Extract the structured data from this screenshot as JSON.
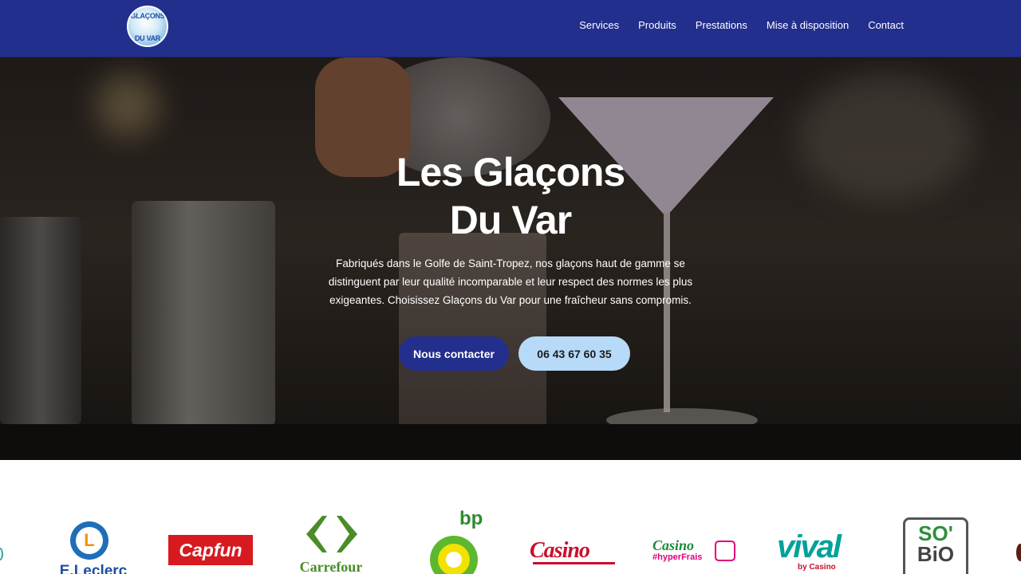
{
  "header": {
    "logo_alt": "Glaçons du Var",
    "logo_line1": "GLAÇONS",
    "logo_line2": "DU VAR",
    "nav": [
      "Services",
      "Produits",
      "Prestations",
      "Mise à disposition",
      "Contact"
    ]
  },
  "hero": {
    "title_line1": "Les Glaçons",
    "title_line2": "Du Var",
    "description_line1": "Fabriqués dans le Golfe de Saint-Tropez, nos glaçons haut de gamme se",
    "description_line2": "distinguent par leur qualité incomparable et leur respect des normes les plus",
    "description_line3": "exigeantes. Choisissez Glaçons du Var pour une fraîcheur sans compromis.",
    "primary_button": "Nous contacter",
    "phone_button": "06 43 67 60 35"
  },
  "partners": {
    "leclerc_letter": "L",
    "leclerc": "E.Leclerc",
    "capfun": "Capfun",
    "carrefour": "Carrefour",
    "bp": "bp",
    "casino": "Casino",
    "casino_hyper": "Casino",
    "casino_hyper_sub": "#hyperFrais",
    "vival": "vival",
    "vival_sub": "by Casino",
    "sobio_line1": "SO'",
    "sobio_line2": "BiO"
  },
  "colors": {
    "header_bg": "#232f8c",
    "primary_button": "#232f8c",
    "phone_button": "#b6daf7"
  }
}
